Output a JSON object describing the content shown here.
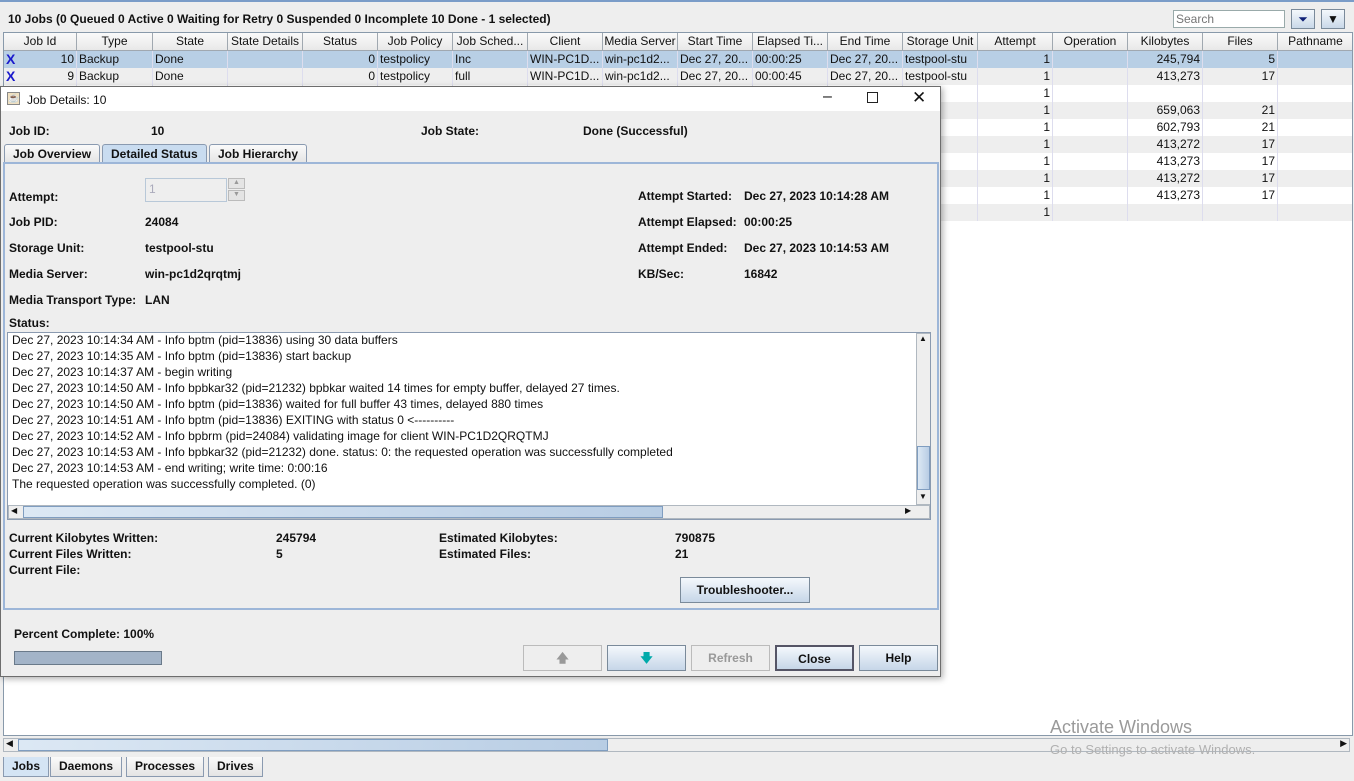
{
  "summary": "10 Jobs (0 Queued 0 Active 0 Waiting for Retry 0 Suspended 0 Incomplete 10 Done - 1 selected)",
  "search": {
    "placeholder": "Search"
  },
  "colors": {
    "selected_row": "#b8cfe5",
    "accent": "#7a9cc8"
  },
  "columns": [
    "Job Id",
    "Type",
    "State",
    "State Details",
    "Status",
    "Job Policy",
    "Job Sched...",
    "Client",
    "Media Server",
    "Start Time",
    "Elapsed Ti...",
    "End Time",
    "Storage Unit",
    "Attempt",
    "Operation",
    "Kilobytes",
    "Files",
    "Pathname"
  ],
  "rows": [
    {
      "selected": true,
      "icon": "running-man-icon",
      "cells": [
        "10",
        "Backup",
        "Done",
        "",
        "0",
        "testpolicy",
        "Inc",
        "WIN-PC1D...",
        "win-pc1d2...",
        "Dec 27, 20...",
        "00:00:25",
        "Dec 27, 20...",
        "testpool-stu",
        "1",
        "",
        "245,794",
        "5",
        ""
      ]
    },
    {
      "selected": false,
      "icon": "running-man-icon",
      "cells": [
        "9",
        "Backup",
        "Done",
        "",
        "0",
        "testpolicy",
        "full",
        "WIN-PC1D...",
        "win-pc1d2...",
        "Dec 27, 20...",
        "00:00:45",
        "Dec 27, 20...",
        "testpool-stu",
        "1",
        "",
        "413,273",
        "17",
        ""
      ]
    },
    {
      "cells": [
        "",
        "",
        "",
        "",
        "",
        "",
        "",
        "",
        "",
        "",
        "",
        "",
        "",
        "1",
        "",
        "",
        "",
        ""
      ]
    },
    {
      "cells": [
        "",
        "",
        "",
        "",
        "",
        "",
        "",
        "",
        "",
        "",
        "",
        "",
        "l-stu",
        "1",
        "",
        "659,063",
        "21",
        ""
      ]
    },
    {
      "cells": [
        "",
        "",
        "",
        "",
        "",
        "",
        "",
        "",
        "",
        "",
        "",
        "",
        "l-stu",
        "1",
        "",
        "602,793",
        "21",
        ""
      ]
    },
    {
      "cells": [
        "",
        "",
        "",
        "",
        "",
        "",
        "",
        "",
        "",
        "",
        "",
        "",
        "",
        "1",
        "",
        "413,272",
        "17",
        ""
      ]
    },
    {
      "cells": [
        "",
        "",
        "",
        "",
        "",
        "",
        "",
        "",
        "",
        "",
        "",
        "",
        "l-stu",
        "1",
        "",
        "413,273",
        "17",
        ""
      ]
    },
    {
      "cells": [
        "",
        "",
        "",
        "",
        "",
        "",
        "",
        "",
        "",
        "",
        "",
        "",
        "",
        "1",
        "",
        "413,272",
        "17",
        ""
      ]
    },
    {
      "cells": [
        "",
        "",
        "",
        "",
        "",
        "",
        "",
        "",
        "",
        "",
        "",
        "",
        "l-stu",
        "1",
        "",
        "413,273",
        "17",
        ""
      ]
    },
    {
      "cells": [
        "",
        "",
        "",
        "",
        "",
        "",
        "",
        "",
        "",
        "",
        "",
        "",
        "",
        "1",
        "",
        "",
        "",
        ""
      ]
    }
  ],
  "dialog": {
    "title": "Job Details: 10",
    "job_id_label": "Job ID:",
    "job_id": "10",
    "job_state_label": "Job State:",
    "job_state": "Done (Successful)",
    "tabs": [
      "Job Overview",
      "Detailed Status",
      "Job Hierarchy"
    ],
    "attempt_label": "Attempt:",
    "attempt": "1",
    "job_pid_label": "Job PID:",
    "job_pid": "24084",
    "storage_unit_label": "Storage Unit:",
    "storage_unit": "testpool-stu",
    "media_server_label": "Media Server:",
    "media_server": "win-pc1d2qrqtmj",
    "transport_label": "Media Transport Type:",
    "transport": "LAN",
    "attempt_started_label": "Attempt Started:",
    "attempt_started": "Dec 27, 2023 10:14:28 AM",
    "attempt_elapsed_label": "Attempt Elapsed:",
    "attempt_elapsed": "00:00:25",
    "attempt_ended_label": "Attempt Ended:",
    "attempt_ended": "Dec 27, 2023 10:14:53 AM",
    "kbsec_label": "KB/Sec:",
    "kbsec": "16842",
    "status_label": "Status:",
    "log": [
      "Dec 27, 2023 10:14:34 AM - Info bptm (pid=13836) using 30 data buffers",
      "Dec 27, 2023 10:14:35 AM - Info bptm (pid=13836) start backup",
      "Dec 27, 2023 10:14:37 AM - begin writing",
      "Dec 27, 2023 10:14:50 AM - Info bpbkar32 (pid=21232) bpbkar waited 14 times for empty buffer, delayed 27 times.",
      "Dec 27, 2023 10:14:50 AM - Info bptm (pid=13836) waited for full buffer 43 times, delayed 880 times",
      "Dec 27, 2023 10:14:51 AM - Info bptm (pid=13836) EXITING with status 0 <----------",
      "Dec 27, 2023 10:14:52 AM - Info bpbrm (pid=24084) validating image for client WIN-PC1D2QRQTMJ",
      "Dec 27, 2023 10:14:53 AM - Info bpbkar32 (pid=21232) done. status: 0: the requested operation was successfully completed",
      "Dec 27, 2023 10:14:53 AM - end writing; write time: 0:00:16",
      "The requested operation was successfully completed.  (0)"
    ],
    "cur_kb_label": "Current Kilobytes Written:",
    "cur_kb": "245794",
    "cur_files_label": "Current Files Written:",
    "cur_files": "5",
    "cur_file_label": "Current File:",
    "est_kb_label": "Estimated Kilobytes:",
    "est_kb": "790875",
    "est_files_label": "Estimated Files:",
    "est_files": "21",
    "troubleshooter": "Troubleshooter...",
    "percent_label": "Percent Complete: 100%",
    "percent": 100,
    "buttons": {
      "refresh": "Refresh",
      "close": "Close",
      "help": "Help"
    }
  },
  "bottom_tabs": [
    "Jobs",
    "Daemons",
    "Processes",
    "Drives"
  ],
  "watermark": {
    "line1": "Activate Windows",
    "line2": "Go to Settings to activate Windows."
  }
}
